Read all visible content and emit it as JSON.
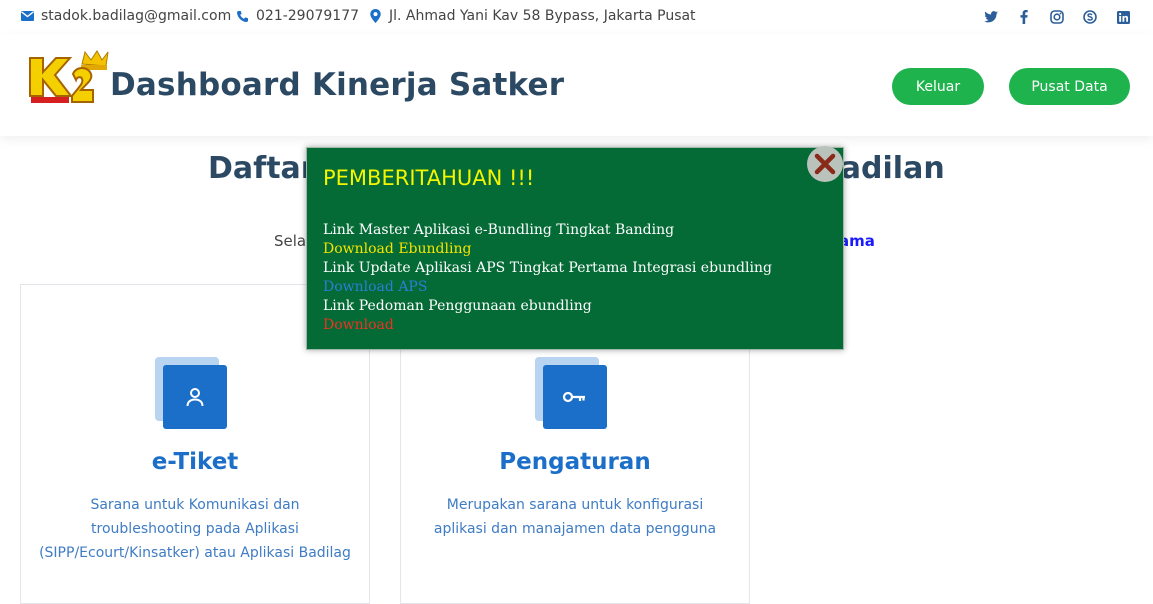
{
  "topbar": {
    "email": "stadok.badilag@gmail.com",
    "phone": "021-29079177",
    "address": "Jl. Ahmad Yani Kav 58 Bypass, Jakarta Pusat"
  },
  "header": {
    "brand": "Dashboard Kinerja Satker",
    "keluar_label": "Keluar",
    "pusat_data_label": "Pusat Data"
  },
  "section": {
    "title_left": "Daftar",
    "title_right": "radilan",
    "sub_left": "Sela",
    "sub_right": "ama"
  },
  "cards": [
    {
      "title": "e-Tiket",
      "desc": "Sarana untuk Komunikasi dan troubleshooting pada Aplikasi (SIPP/Ecourt/Kinsatker) atau Aplikasi Badilag"
    },
    {
      "title": "Pengaturan",
      "desc": "Merupakan sarana untuk konfigurasi aplikasi dan manajamen data pengguna"
    }
  ],
  "modal": {
    "title": "PEMBERITAHUAN !!!",
    "lines": [
      "Link Master Aplikasi e-Bundling Tingkat Banding",
      "Download Ebundling",
      "Link Update Aplikasi APS Tingkat Pertama Integrasi ebundling",
      "Download APS",
      "Link Pedoman Penggunaan ebundling",
      "Download"
    ]
  },
  "colors": {
    "accent_green": "#1fb34e",
    "brand_navy": "#2c4964",
    "card_blue": "#1c6fc9",
    "modal_bg": "#046a36"
  },
  "icons": [
    "envelope-icon",
    "phone-icon",
    "map-pin-icon",
    "twitter-icon",
    "facebook-icon",
    "instagram-icon",
    "skype-icon",
    "linkedin-icon",
    "user-icon",
    "key-icon",
    "close-icon"
  ]
}
